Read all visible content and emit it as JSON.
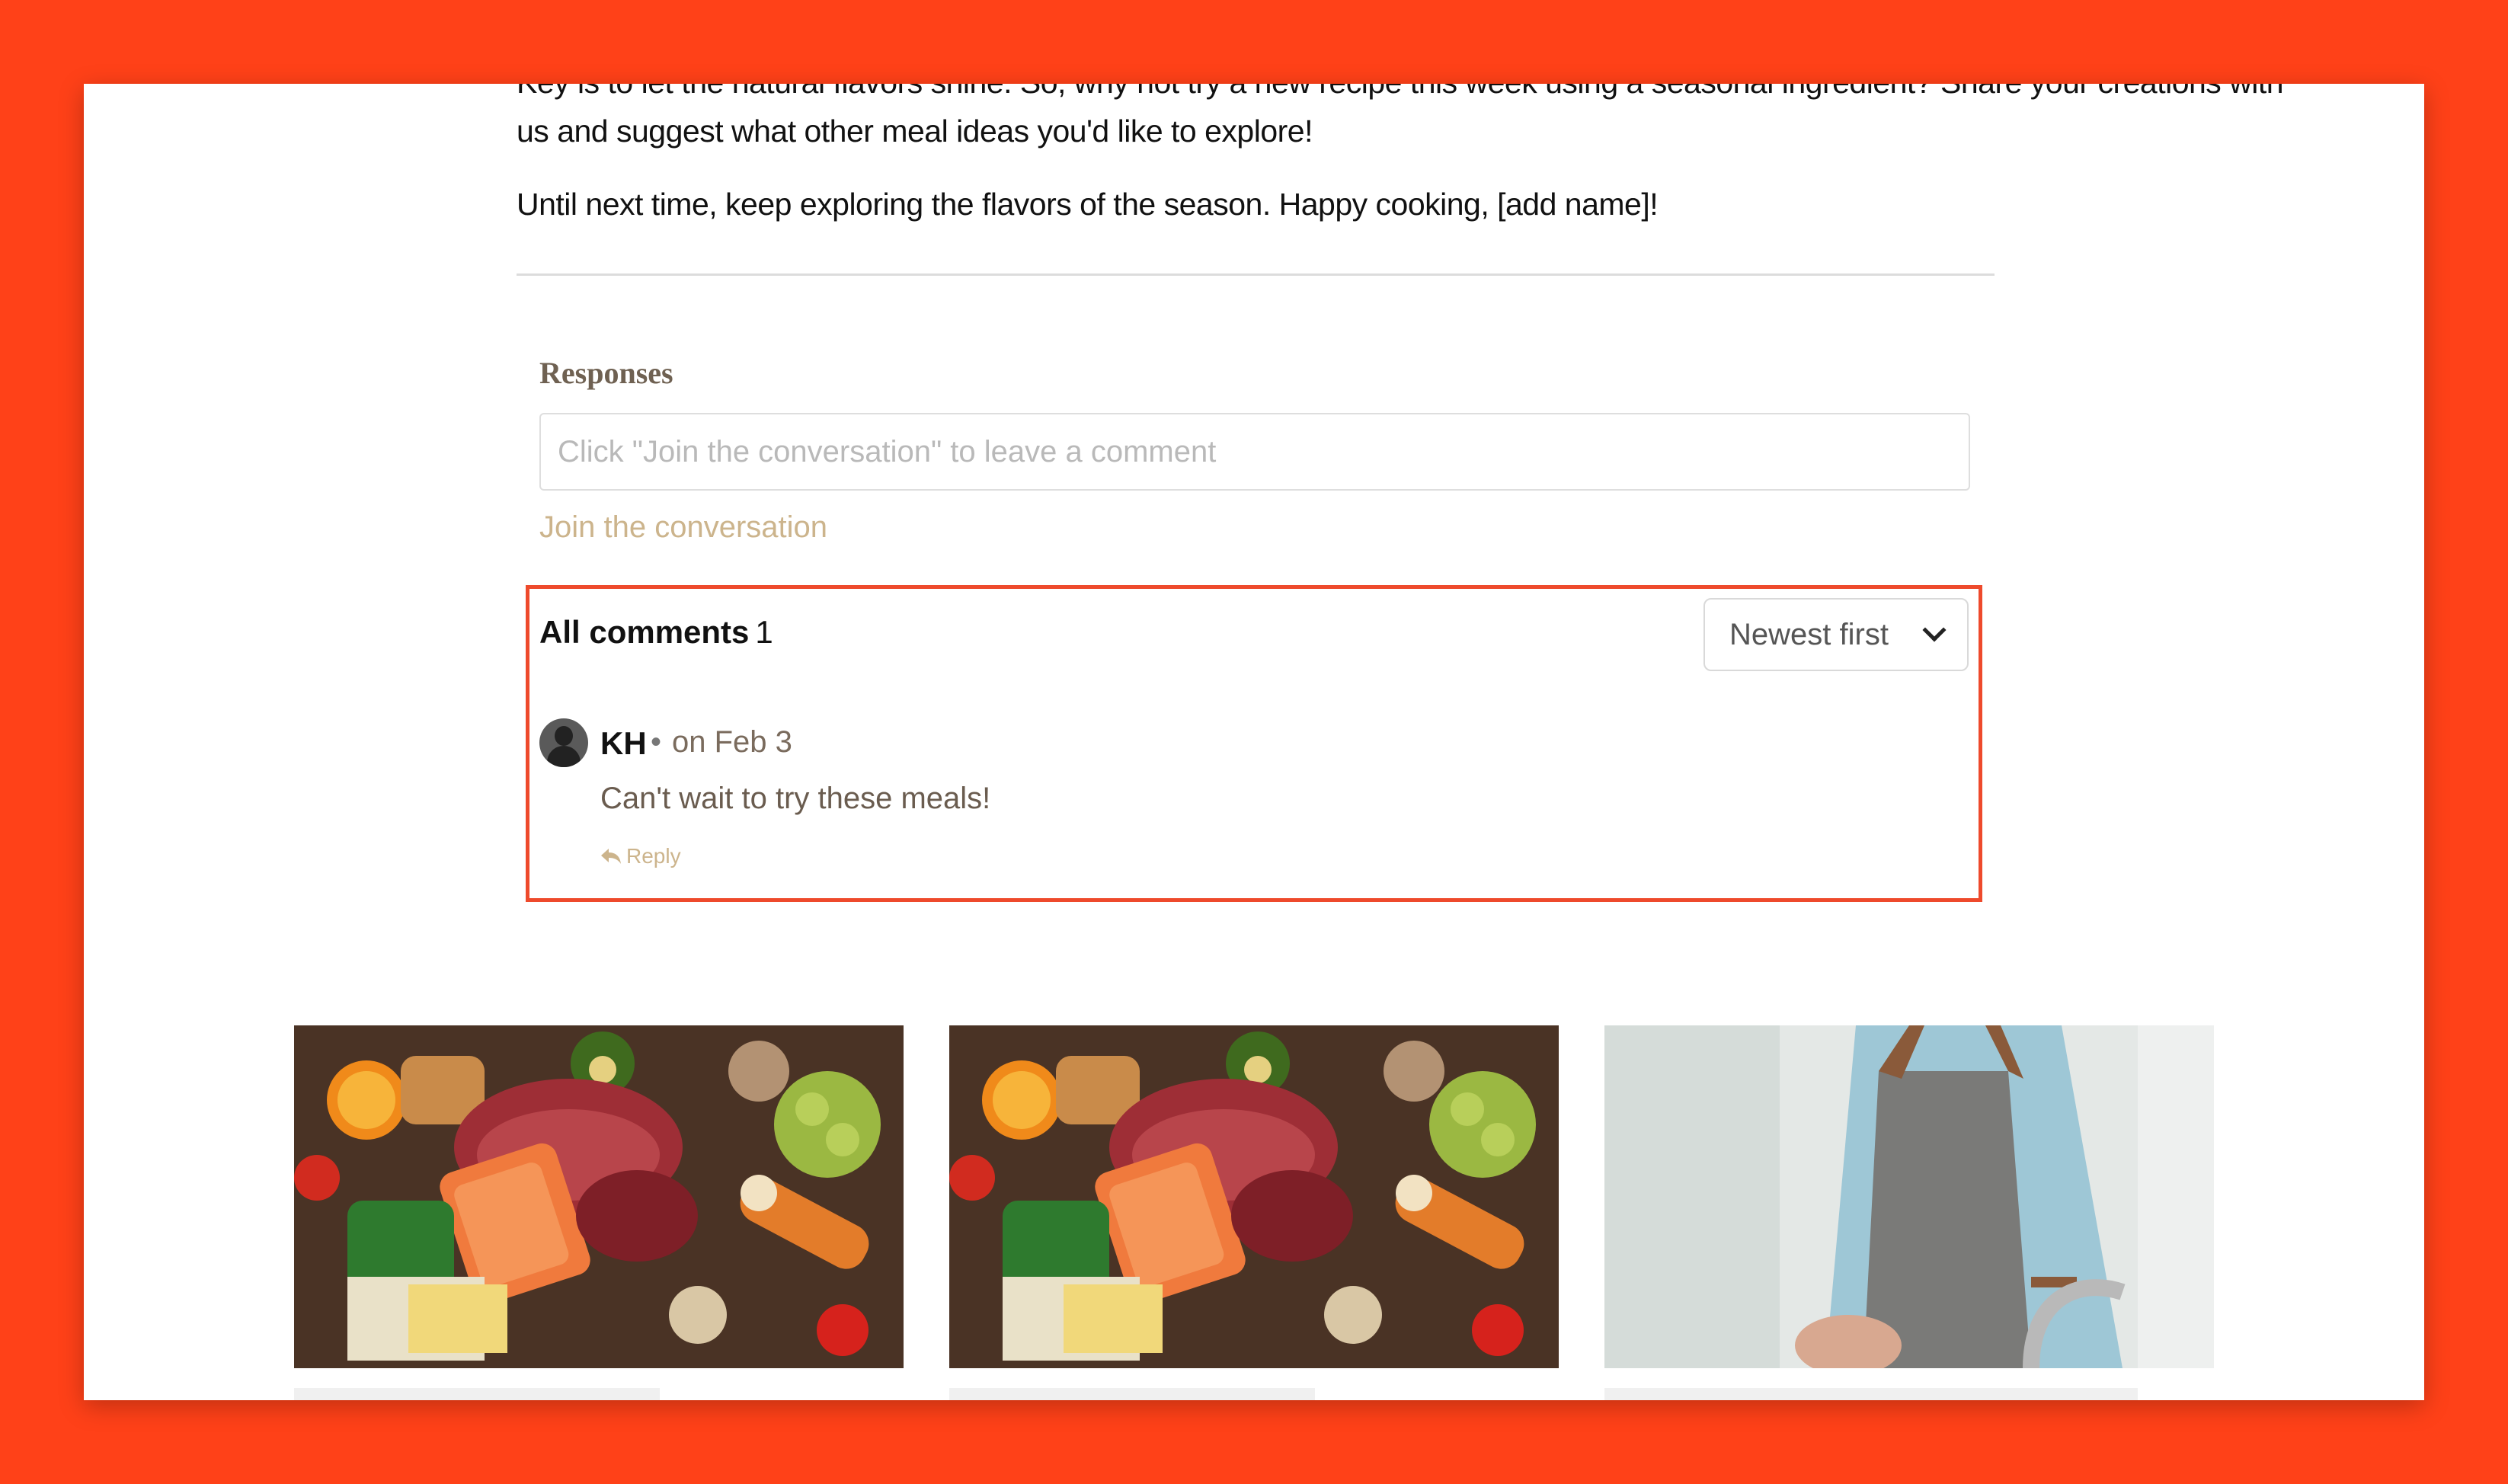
{
  "article": {
    "paragraph_cut": "Key is to let the natural flavors shine. So, why not try a new recipe this week using a seasonal ingredient? Share your creations with",
    "paragraph_cut_rest": "us and suggest what other meal ideas you'd like to explore!",
    "closing": "Until next time, keep exploring the flavors of the season. Happy cooking, [add name]!"
  },
  "responses": {
    "title": "Responses",
    "input_placeholder": "Click \"Join the conversation\" to leave a comment",
    "join_label": "Join the conversation"
  },
  "comments": {
    "header_label": "All comments",
    "count": "1",
    "sort_label": "Newest first",
    "items": [
      {
        "author": "KH",
        "separator": "•",
        "date": "on Feb 3",
        "text": "Can't wait to try these meals!",
        "reply_label": "Reply"
      }
    ]
  },
  "colors": {
    "background": "#ff4118",
    "highlight_border": "#ee4a2c",
    "accent_link": "#ccb48c"
  },
  "related_cards": [
    {
      "image": "food-spread-image"
    },
    {
      "image": "food-spread-image"
    },
    {
      "image": "chef-apron-image"
    }
  ]
}
